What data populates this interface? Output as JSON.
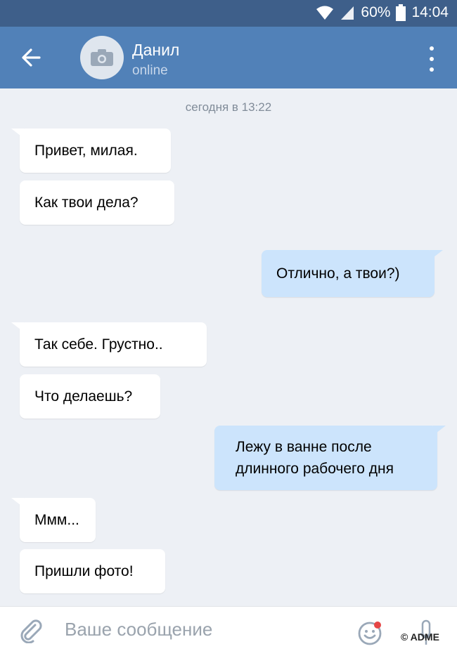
{
  "status_bar": {
    "battery": "60%",
    "time": "14:04"
  },
  "header": {
    "contact_name": "Данил",
    "presence": "online"
  },
  "conversation": {
    "date_divider": "сегодня в 13:22",
    "messages": [
      {
        "direction": "in",
        "text": "Привет, милая."
      },
      {
        "direction": "in",
        "text": "Как твои дела?"
      },
      {
        "direction": "out",
        "text": "Отлично, а твои?)"
      },
      {
        "direction": "in",
        "text": "Так себе. Грустно.."
      },
      {
        "direction": "in",
        "text": "Что делаешь?"
      },
      {
        "direction": "out",
        "text": "Лежу в ванне после длинного рабочего дня"
      },
      {
        "direction": "in",
        "text": "Ммм..."
      },
      {
        "direction": "in",
        "text": "Пришли фото!"
      }
    ]
  },
  "composer": {
    "placeholder": "Ваше сообщение"
  },
  "watermark": "© ADME",
  "colors": {
    "header": "#5181b8",
    "status_bar": "#3e5f8a",
    "incoming": "#ffffff",
    "outgoing": "#cce4fc",
    "background": "#edf0f5"
  },
  "icons": {
    "back": "arrow-left-icon",
    "avatar": "camera-icon",
    "menu": "more-vertical-icon",
    "attach": "paperclip-icon",
    "emoji": "smile-icon",
    "mic": "microphone-icon"
  }
}
